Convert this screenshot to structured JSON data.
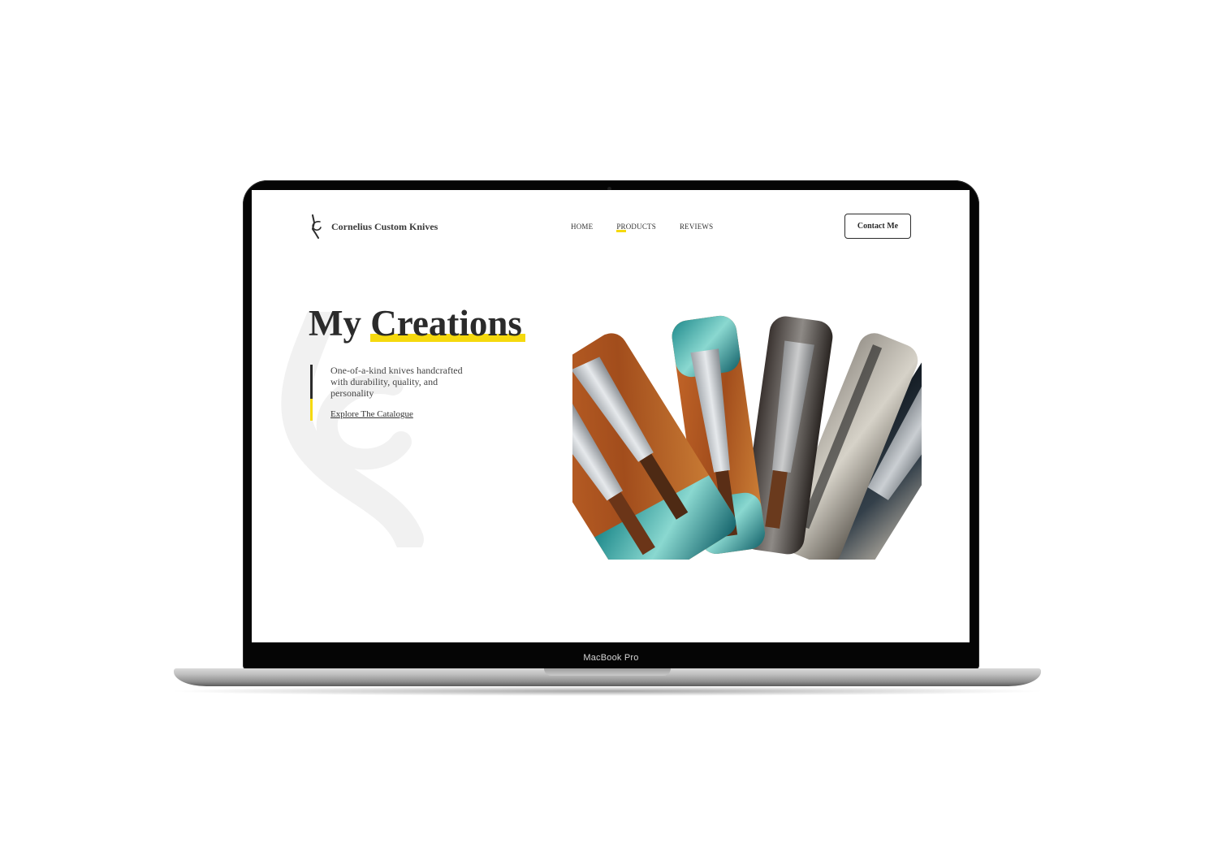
{
  "device": {
    "label": "MacBook Pro"
  },
  "site": {
    "brand": "Cornelius Custom Knives",
    "logo_icon": "knife-monogram-icon",
    "nav": [
      {
        "label": "HOME",
        "active": false
      },
      {
        "label": "PRODUCTS",
        "active": true
      },
      {
        "label": "REVIEWS",
        "active": false
      }
    ],
    "contact_label": "Contact Me"
  },
  "hero": {
    "title_plain": "My ",
    "title_highlight": "Creations",
    "description": "One-of-a-kind knives handcrafted with durability, quality, and personality",
    "cta_label": "Explore The Catalogue",
    "images": [
      "knives-on-wood-and-resin-board-image",
      "knife-on-turquoise-resin-image",
      "damascus-knife-image",
      "knife-on-granite-image",
      "cleaver-on-dark-stone-image"
    ]
  },
  "colors": {
    "accent": "#f5d90e",
    "text": "#2b2b2b",
    "frame": "#050505",
    "screen_bg": "#ffffff"
  }
}
